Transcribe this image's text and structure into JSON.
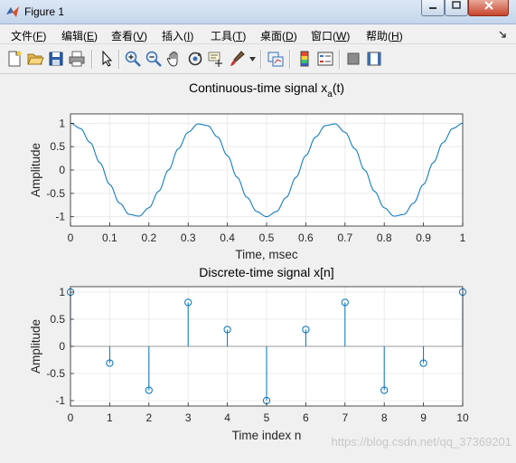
{
  "window": {
    "title": "Figure 1"
  },
  "menu": [
    {
      "label": "文件",
      "key": "F"
    },
    {
      "label": "编辑",
      "key": "E"
    },
    {
      "label": "查看",
      "key": "V"
    },
    {
      "label": "插入",
      "key": "I"
    },
    {
      "label": "工具",
      "key": "T"
    },
    {
      "label": "桌面",
      "key": "D"
    },
    {
      "label": "窗口",
      "key": "W"
    },
    {
      "label": "帮助",
      "key": "H"
    }
  ],
  "toolbar": [
    {
      "icon": "new-figure-icon"
    },
    {
      "icon": "open-file-icon"
    },
    {
      "icon": "save-icon"
    },
    {
      "icon": "print-icon"
    },
    {
      "icon": "edit-plot-arrow-icon"
    },
    {
      "icon": "zoom-in-icon"
    },
    {
      "icon": "zoom-out-icon"
    },
    {
      "icon": "pan-hand-icon"
    },
    {
      "icon": "rotate-3d-icon"
    },
    {
      "icon": "data-cursor-icon"
    },
    {
      "icon": "brush-icon"
    },
    {
      "icon": "link-plot-icon"
    },
    {
      "icon": "colorbar-icon"
    },
    {
      "icon": "legend-icon"
    },
    {
      "icon": "hide-plot-tools-icon"
    },
    {
      "icon": "show-plot-tools-icon"
    }
  ],
  "watermark": "https://blog.csdn.net/qq_37369201",
  "colors": {
    "line": "#0072bd",
    "axes_bg": "#ffffff",
    "grid": "#e6e6e6"
  },
  "chart_data": [
    {
      "type": "line",
      "title": "Continuous-time signal x",
      "title_sub": "a",
      "title_suffix": "(t)",
      "xlabel": "Time, msec",
      "ylabel": "Amplitude",
      "xlim": [
        0,
        1
      ],
      "ylim": [
        -1.2,
        1.2
      ],
      "xticks": [
        "0",
        "0.1",
        "0.2",
        "0.3",
        "0.4",
        "0.5",
        "0.6",
        "0.7",
        "0.8",
        "0.9",
        "1"
      ],
      "yticks": [
        "-1",
        "-0.5",
        "0",
        "0.5",
        "1"
      ],
      "grid": true,
      "series": [
        {
          "x": [
            0,
            0.025,
            0.05,
            0.075,
            0.1,
            0.125,
            0.15,
            0.175,
            0.2,
            0.225,
            0.25,
            0.275,
            0.3,
            0.325,
            0.35,
            0.375,
            0.4,
            0.425,
            0.45,
            0.475,
            0.5,
            0.525,
            0.55,
            0.575,
            0.6,
            0.625,
            0.65,
            0.675,
            0.7,
            0.725,
            0.75,
            0.775,
            0.8,
            0.825,
            0.85,
            0.875,
            0.9,
            0.925,
            0.95,
            0.975,
            1
          ],
          "y": [
            1,
            0.891,
            0.588,
            0.156,
            -0.309,
            -0.707,
            -0.951,
            -0.988,
            -0.809,
            -0.454,
            0,
            0.454,
            0.809,
            0.988,
            0.951,
            0.707,
            0.309,
            -0.156,
            -0.588,
            -0.891,
            -1,
            -0.891,
            -0.588,
            -0.156,
            0.309,
            0.707,
            0.951,
            0.988,
            0.809,
            0.454,
            0,
            -0.454,
            -0.809,
            -0.988,
            -0.951,
            -0.707,
            -0.309,
            0.156,
            0.588,
            0.891,
            1
          ]
        }
      ]
    },
    {
      "type": "stem",
      "title": "Discrete-time signal x[n]",
      "xlabel": "Time index n",
      "ylabel": "Amplitude",
      "xlim": [
        0,
        10
      ],
      "ylim": [
        -1.1,
        1.1
      ],
      "xticks": [
        "0",
        "1",
        "2",
        "3",
        "4",
        "5",
        "6",
        "7",
        "8",
        "9",
        "10"
      ],
      "yticks": [
        "-1",
        "-0.5",
        "0",
        "0.5",
        "1"
      ],
      "grid": true,
      "series": [
        {
          "x": [
            0,
            1,
            2,
            3,
            4,
            5,
            6,
            7,
            8,
            9,
            10
          ],
          "y": [
            1,
            -0.309,
            -0.809,
            0.809,
            0.309,
            -1,
            0.309,
            0.809,
            -0.809,
            -0.309,
            1
          ]
        }
      ]
    }
  ]
}
